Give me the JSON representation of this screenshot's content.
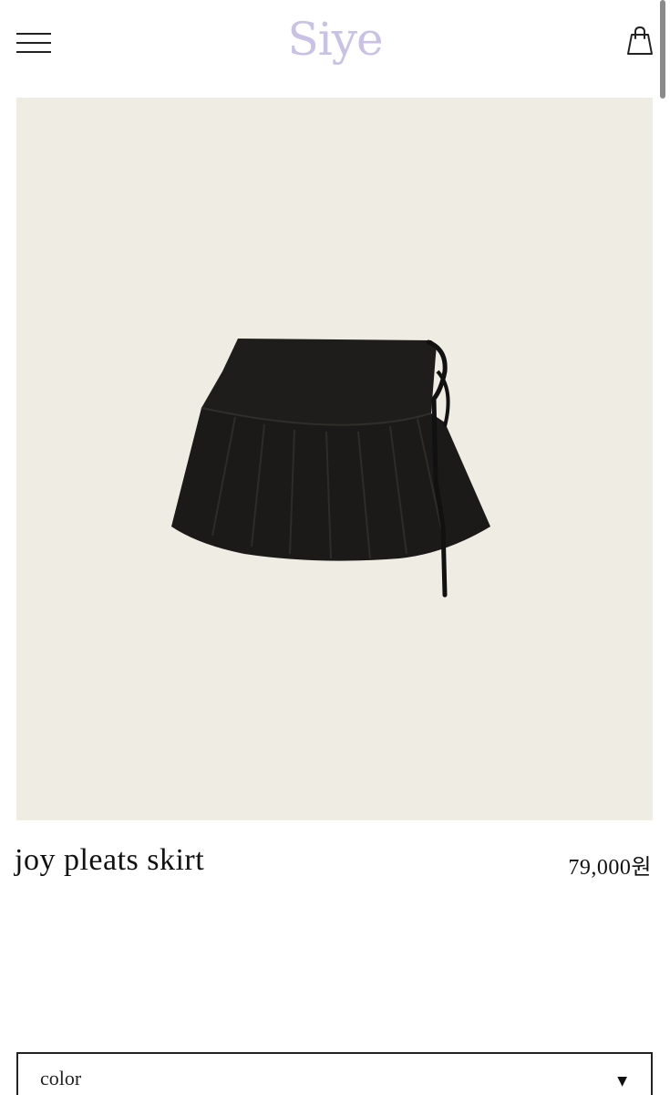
{
  "header": {
    "logo_text": "Siye",
    "menu_icon": "hamburger-menu-icon",
    "cart_icon": "shopping-bag-icon"
  },
  "product": {
    "name": "joy pleats skirt",
    "price": "79,000원",
    "image_alt": "black pleated mini skirt with side tie"
  },
  "options": {
    "color_label": "color",
    "caret_icon": "triangle-down-icon"
  },
  "colors": {
    "logo": "#c9c2e6",
    "image_background": "#efece4",
    "skirt": "#1f1d1b"
  }
}
